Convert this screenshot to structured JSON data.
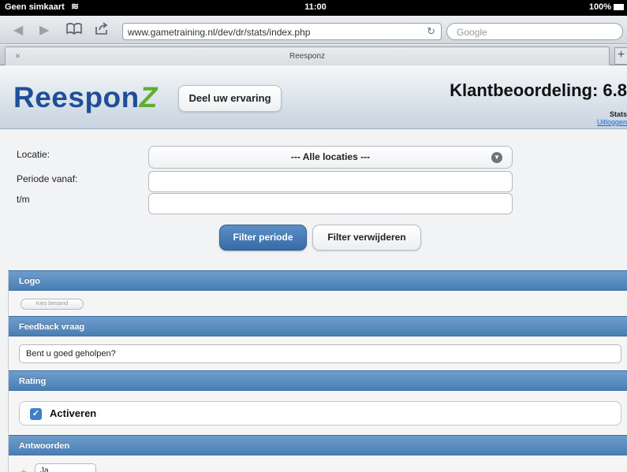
{
  "status_bar": {
    "carrier": "Geen simkaart",
    "time": "11:00",
    "battery": "100%"
  },
  "browser": {
    "url": "www.gametraining.nl/dev/dr/stats/index.php",
    "search_placeholder": "Google",
    "tab_title": "Reesponz",
    "tab_close": "×",
    "tab_add": "+"
  },
  "header": {
    "logo_main": "Reespon",
    "logo_z": "Z",
    "share_button": "Deel uw ervaring",
    "rating_title": "Klantbeoordeling: 6.8",
    "stats_label": "Stats",
    "logout_link": "Uitloggen"
  },
  "filter": {
    "location_label": "Locatie:",
    "location_value": "--- Alle locaties ---",
    "period_from_label": "Periode vanaf:",
    "period_to_label": "t/m",
    "period_from_value": "",
    "period_to_value": "",
    "filter_button": "Filter periode",
    "remove_button": "Filter verwijderen"
  },
  "settings": {
    "logo_header": "Logo",
    "file_button": "Kies bestand",
    "feedback_header": "Feedback vraag",
    "feedback_question": "Bent u goed geholpen?",
    "rating_header": "Rating",
    "activate_label": "Activeren",
    "activate_checked": true,
    "answers_header": "Antwoorden",
    "first_answer": "Ja"
  },
  "colors": {
    "section_header": "#5a8cc0",
    "primary_button": "#4a7fb8",
    "logo_blue": "#1f4f99",
    "logo_green": "#5fae2f"
  }
}
